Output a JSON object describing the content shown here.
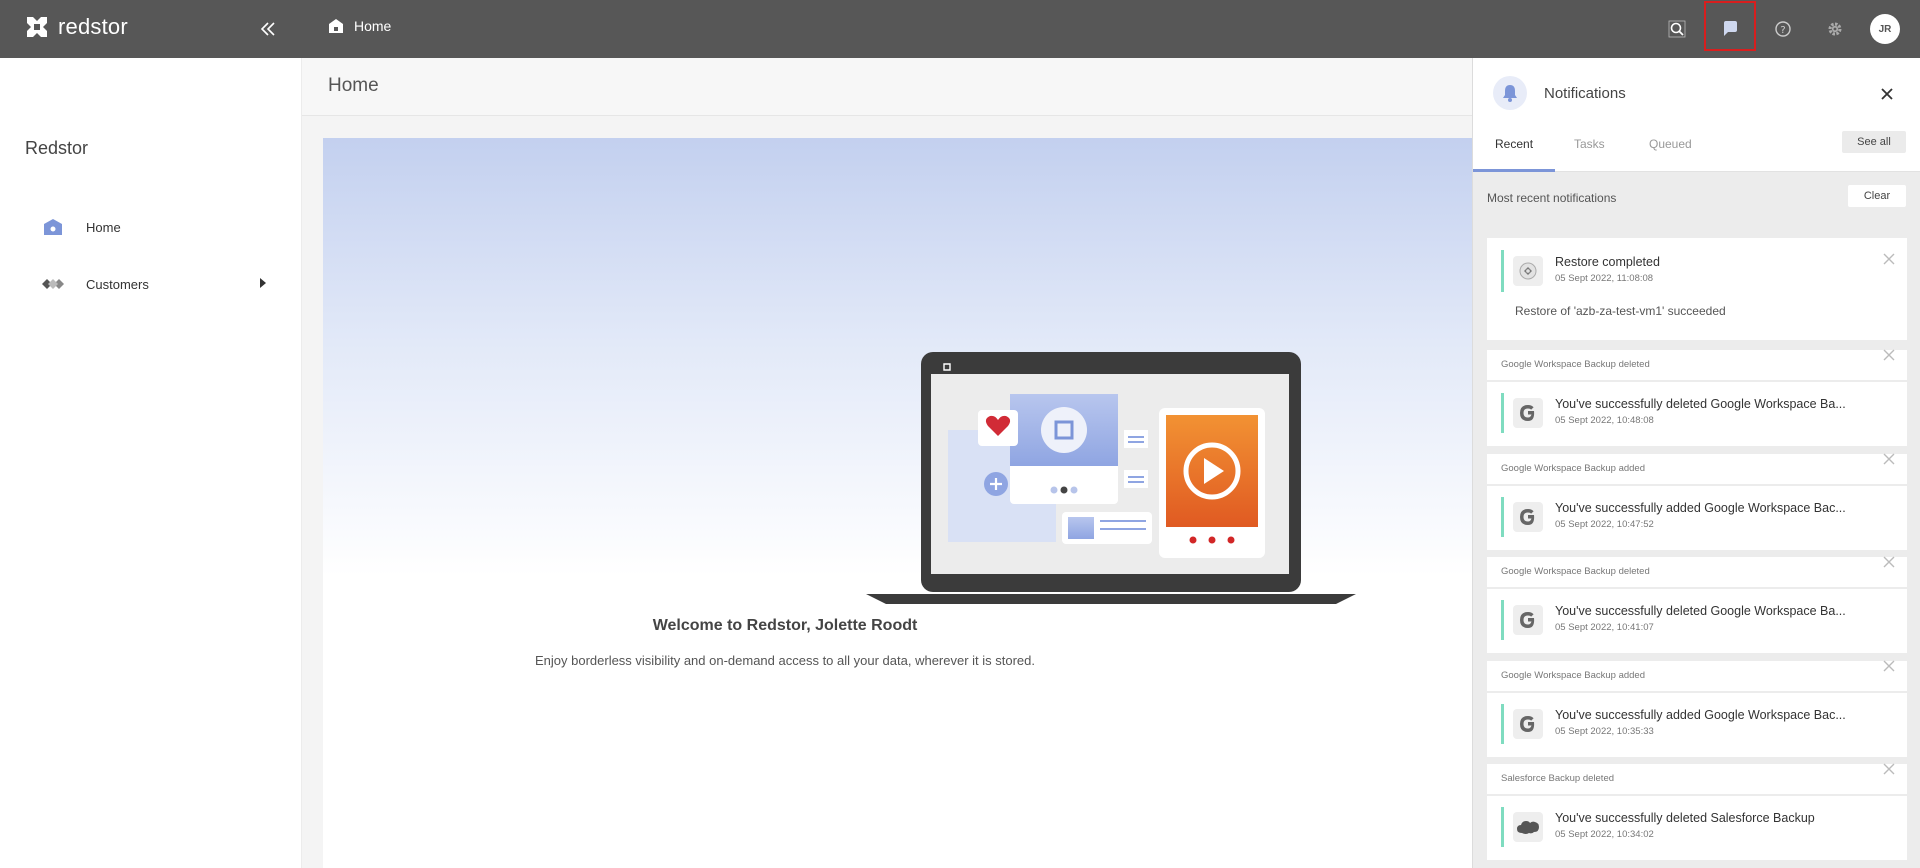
{
  "topbar": {
    "logo_text": "redstor",
    "breadcrumb": "Home",
    "avatar_initials": "JR",
    "icons": [
      "search-icon",
      "notifications-icon",
      "help-icon",
      "settings-icon"
    ]
  },
  "sidebar": {
    "title": "Redstor",
    "items": [
      {
        "label": "Home",
        "icon": "home-icon"
      },
      {
        "label": "Customers",
        "icon": "customers-icon"
      }
    ]
  },
  "main": {
    "page_title": "Home",
    "welcome_title": "Welcome to Redstor, Jolette Roodt",
    "welcome_subtitle": "Enjoy borderless visibility and on-demand access to all your data, wherever it is stored."
  },
  "notifications": {
    "title": "Notifications",
    "tabs": [
      "Recent",
      "Tasks",
      "Queued"
    ],
    "active_tab": "Recent",
    "see_all": "See all",
    "section_label": "Most recent notifications",
    "clear_label": "Clear",
    "items": [
      {
        "group": "",
        "title": "Restore completed",
        "date": "05 Sept 2022, 11:08:08",
        "body": "Restore of 'azb-za-test-vm1' succeeded",
        "icon": "restore-icon"
      },
      {
        "group": "Google Workspace Backup deleted",
        "title": "You've successfully deleted Google Workspace Ba...",
        "date": "05 Sept 2022, 10:48:08",
        "icon": "google-icon"
      },
      {
        "group": "Google Workspace Backup added",
        "title": "You've successfully added Google Workspace Bac...",
        "date": "05 Sept 2022, 10:47:52",
        "icon": "google-icon"
      },
      {
        "group": "Google Workspace Backup deleted",
        "title": "You've successfully deleted Google Workspace Ba...",
        "date": "05 Sept 2022, 10:41:07",
        "icon": "google-icon"
      },
      {
        "group": "Google Workspace Backup added",
        "title": "You've successfully added Google Workspace Bac...",
        "date": "05 Sept 2022, 10:35:33",
        "icon": "google-icon"
      },
      {
        "group": "Salesforce Backup deleted",
        "title": "You've successfully deleted Salesforce Backup",
        "date": "05 Sept 2022, 10:34:02",
        "icon": "salesforce-icon"
      }
    ]
  },
  "colors": {
    "topbar": "#575757",
    "accent": "#7c95d8",
    "success_accent": "#7fdcc0",
    "highlight": "#d81e1e"
  }
}
